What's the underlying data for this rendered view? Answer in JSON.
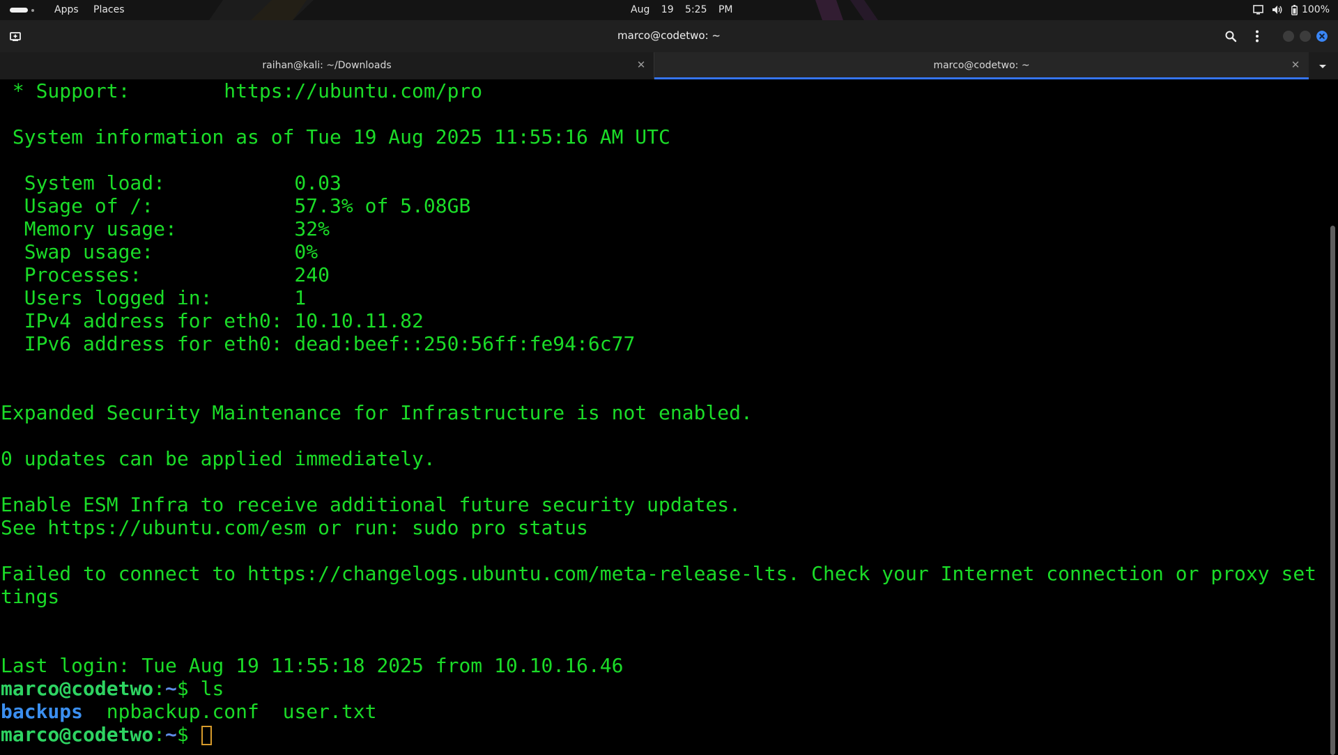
{
  "topbar": {
    "apps_label": "Apps",
    "places_label": "Places",
    "datetime": "Aug 19   5:25 PM",
    "battery_percent": "100%",
    "icons": [
      "activities-icon",
      "screen-icon",
      "volume-icon",
      "battery-icon"
    ]
  },
  "window": {
    "title": "marco@codetwo: ~",
    "icons": [
      "new-tab-icon",
      "search-icon",
      "kebab-menu-icon",
      "minimize-icon",
      "maximize-icon",
      "close-icon",
      "tabs-dropdown-icon"
    ],
    "colors": {
      "accent": "#3574f0",
      "close_button": "#3a86f5"
    }
  },
  "tabs": [
    {
      "label": "raihan@kali: ~/Downloads",
      "active": false
    },
    {
      "label": "marco@codetwo: ~",
      "active": true
    }
  ],
  "terminal": {
    "colors": {
      "text": "#1bdc28",
      "host": "#2ed462",
      "cwd": "#5f8de8",
      "directory": "#3b8ff0",
      "cursor": "#d79b2b"
    },
    "lines": {
      "support": " * Support:        https://ubuntu.com/pro",
      "sysinfo": " System information as of Tue 19 Aug 2025 11:55:16 AM UTC",
      "load": "  System load:           0.03",
      "usage": "  Usage of /:            57.3% of 5.08GB",
      "memory": "  Memory usage:          32%",
      "swap": "  Swap usage:            0%",
      "processes": "  Processes:             240",
      "users": "  Users logged in:       1",
      "ipv4": "  IPv4 address for eth0: 10.10.11.82",
      "ipv6": "  IPv6 address for eth0: dead:beef::250:56ff:fe94:6c77",
      "esm": "Expanded Security Maintenance for Infrastructure is not enabled.",
      "updates": "0 updates can be applied immediately.",
      "enable_esm": "Enable ESM Infra to receive additional future security updates.",
      "see_esm": "See https://ubuntu.com/esm or run: sudo pro status",
      "failed": "Failed to connect to https://changelogs.ubuntu.com/meta-release-lts. Check your Internet connection or proxy set",
      "failed_wrap": "tings",
      "last_login": "Last login: Tue Aug 19 11:55:18 2025 from 10.10.16.46"
    },
    "prompt": {
      "user_host": "marco@codetwo",
      "separator": ":",
      "cwd": "~",
      "symbol": "$ "
    },
    "command": "ls",
    "ls_output": {
      "dir": "backups",
      "files": "  npbackup.conf  user.txt"
    }
  }
}
